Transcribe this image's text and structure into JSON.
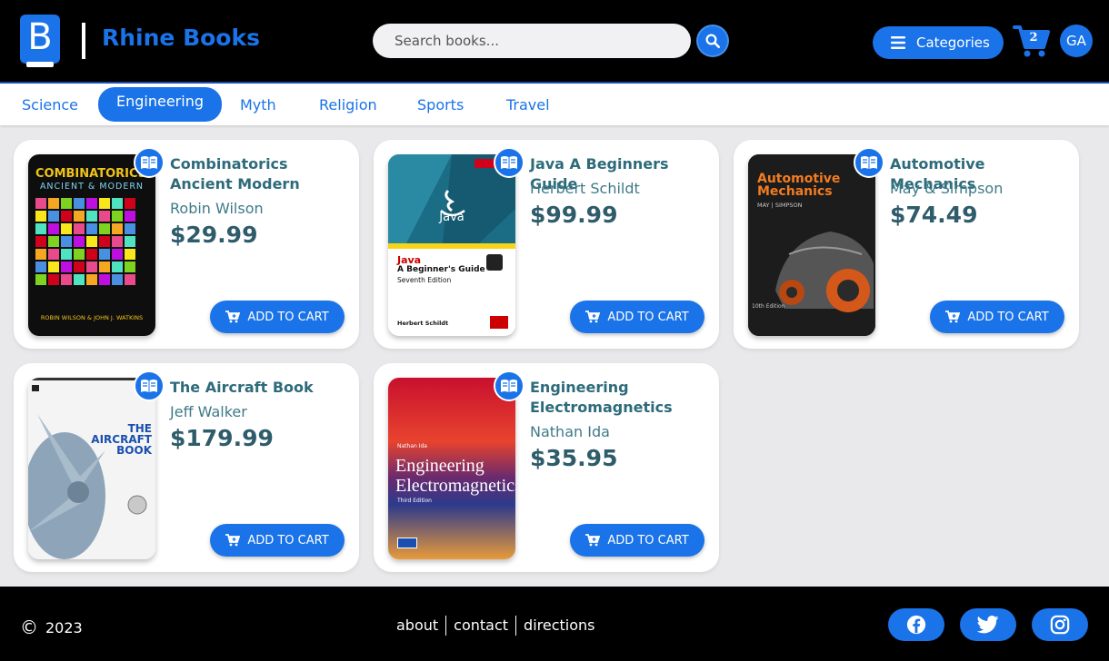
{
  "header": {
    "brand_name": "Rhine Books",
    "logo_letter": "B",
    "search": {
      "placeholder": "Search books..."
    },
    "categories_label": "Categories",
    "cart_count": "2",
    "avatar_initials": "GA"
  },
  "nav": {
    "items": [
      {
        "label": "Science",
        "active": false
      },
      {
        "label": "Engineering",
        "active": true
      },
      {
        "label": "Myth",
        "active": false
      },
      {
        "label": "Religion",
        "active": false
      },
      {
        "label": "Sports",
        "active": false
      },
      {
        "label": "Travel",
        "active": false
      }
    ]
  },
  "books": [
    {
      "title": "Combinatorics Ancient Modern",
      "author": "Robin Wilson",
      "price": "$29.99",
      "add_label": "ADD TO CART",
      "cover": {
        "heading": "COMBINATORICS",
        "subheading": "ANCIENT & MODERN",
        "editors": "ROBIN WILSON & JOHN J. WATKINS"
      }
    },
    {
      "title": "Java A Beginners Guide",
      "author": "Herbert Schildt",
      "price": "$99.99",
      "add_label": "ADD TO CART",
      "cover": {
        "heading": "Java",
        "subheading": "A Beginner's Guide",
        "edition": "Seventh Edition",
        "author": "Herbert Schildt"
      }
    },
    {
      "title": "Automotive Mechanics",
      "author": "May & Simpson",
      "price": "$74.49",
      "add_label": "ADD TO CART",
      "cover": {
        "heading": "Automotive Mechanics",
        "subheading": "MAY | SIMPSON",
        "edition": "10th Edition"
      }
    },
    {
      "title": "The Aircraft Book",
      "author": "Jeff Walker",
      "price": "$179.99",
      "add_label": "ADD TO CART",
      "cover": {
        "heading": "THE AIRCRAFT BOOK"
      }
    },
    {
      "title": "Engineering Electromagnetics",
      "author": "Nathan Ida",
      "price": "$35.95",
      "add_label": "ADD TO CART",
      "cover": {
        "heading": "Engineering Electromagnetics",
        "author": "Nathan Ida",
        "edition": "Third Edition"
      }
    }
  ],
  "footer": {
    "year": "2023",
    "links": [
      "about",
      "contact",
      "directions"
    ]
  },
  "colors": {
    "accent": "#1a73e8",
    "title": "#2e6b7a",
    "price": "#2f5c6b"
  },
  "icons": [
    "book-logo-icon",
    "search-icon",
    "menu-icon",
    "cart-icon",
    "read-book-icon",
    "add-cart-icon",
    "copyright-icon",
    "facebook-icon",
    "twitter-icon",
    "instagram-icon"
  ]
}
